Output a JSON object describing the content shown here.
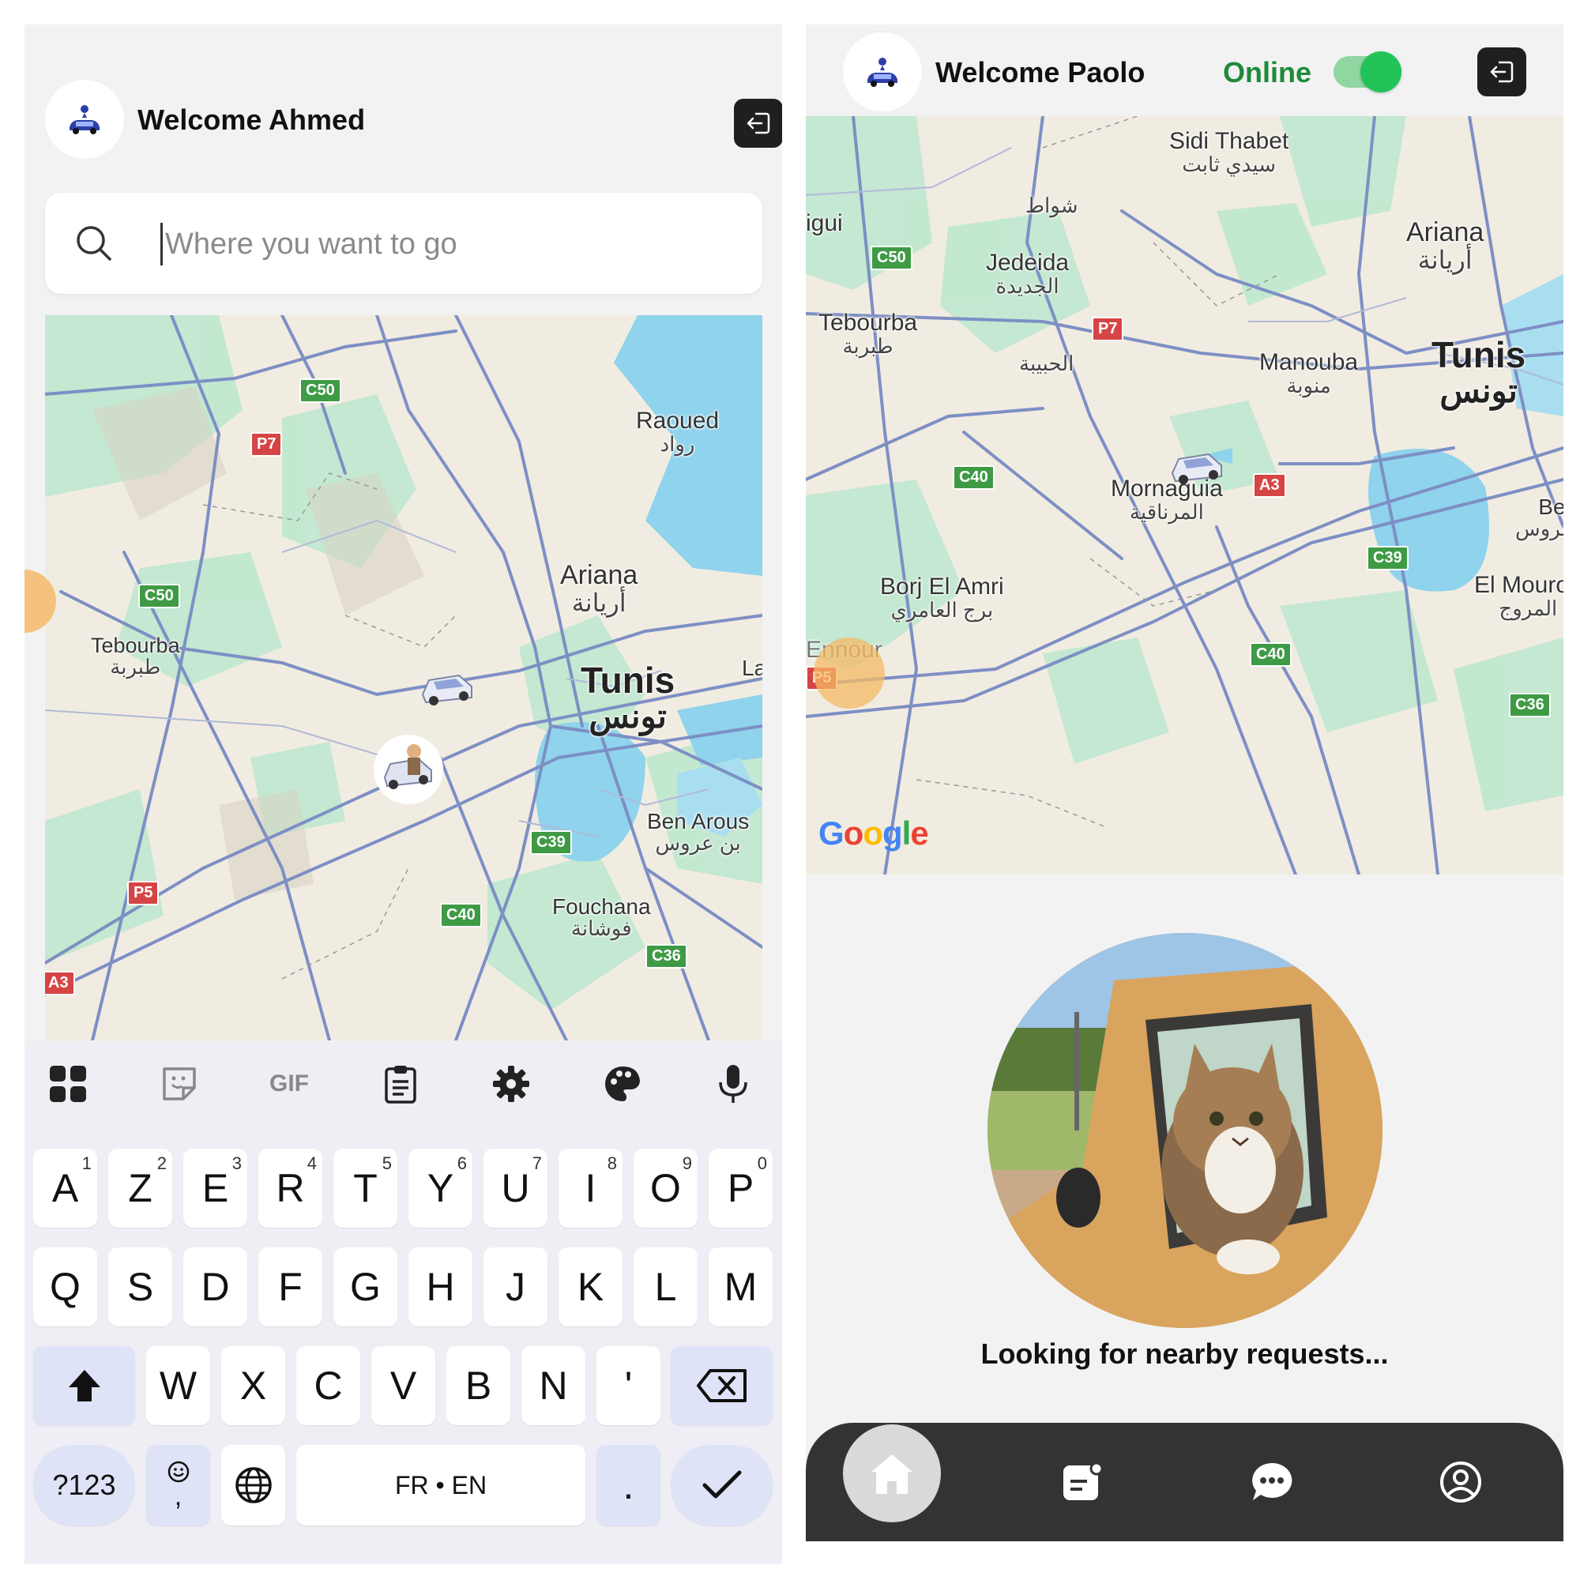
{
  "left_screen": {
    "welcome": "Welcome Ahmed",
    "search": {
      "placeholder": "Where you want to go",
      "value": ""
    },
    "map_places": [
      {
        "name": "Raoued",
        "arabic": "رواد"
      },
      {
        "name": "Ariana",
        "arabic": "أريانة"
      },
      {
        "name": "Tunis",
        "arabic": "تونس"
      },
      {
        "name": "Tebourba",
        "arabic": "طبربة"
      },
      {
        "name": "Ben Arous",
        "arabic": "بن عروس"
      },
      {
        "name": "Fouchana",
        "arabic": "فوشانة"
      },
      {
        "name": "La",
        "arabic": ""
      }
    ],
    "road_shields": [
      "C50",
      "P7",
      "C50",
      "C39",
      "C40",
      "C36",
      "P5",
      "A3"
    ],
    "keyboard": {
      "toolbar": [
        "apps-grid-icon",
        "sticker-icon",
        "GIF",
        "clipboard-icon",
        "settings-gear-icon",
        "palette-icon",
        "microphone-icon"
      ],
      "row1": [
        [
          "A",
          "1"
        ],
        [
          "Z",
          "2"
        ],
        [
          "E",
          "3"
        ],
        [
          "R",
          "4"
        ],
        [
          "T",
          "5"
        ],
        [
          "Y",
          "6"
        ],
        [
          "U",
          "7"
        ],
        [
          "I",
          "8"
        ],
        [
          "O",
          "9"
        ],
        [
          "P",
          "0"
        ]
      ],
      "row2": [
        "Q",
        "S",
        "D",
        "F",
        "G",
        "H",
        "J",
        "K",
        "L",
        "M"
      ],
      "row3": [
        "W",
        "X",
        "C",
        "V",
        "B",
        "N",
        "'"
      ],
      "symbols_key": "?123",
      "emoji_comma_key": ",",
      "space_label": "FR • EN",
      "period_key": ".",
      "colors": {
        "special_key": "#dfe3f7",
        "key": "#ffffff",
        "background": "#eeeef4"
      }
    }
  },
  "right_screen": {
    "welcome": "Welcome Paolo",
    "status": "Online",
    "online_toggle": true,
    "map_places": [
      {
        "name": "Sidi Thabet",
        "arabic": "سيدي ثابت"
      },
      {
        "name": "igui",
        "arabic": ""
      },
      {
        "name": "",
        "arabic": "شواط"
      },
      {
        "name": "Jedeida",
        "arabic": "الجديدة"
      },
      {
        "name": "Ariana",
        "arabic": "أريانة"
      },
      {
        "name": "Tebourba",
        "arabic": "طبربة"
      },
      {
        "name": "",
        "arabic": "الحبيبة"
      },
      {
        "name": "Manouba",
        "arabic": "منوبة"
      },
      {
        "name": "Tunis",
        "arabic": "تونس"
      },
      {
        "name": "Mornaguia",
        "arabic": "المرناقية"
      },
      {
        "name": "Ben",
        "arabic": "بن عروس"
      },
      {
        "name": "Borj El Amri",
        "arabic": "برج العامري"
      },
      {
        "name": "El Mourou",
        "arabic": "المروج"
      },
      {
        "name": "Ennour",
        "arabic": ""
      }
    ],
    "road_shields": [
      "C50",
      "P7",
      "C40",
      "A3",
      "C39",
      "C40",
      "C36",
      "P5"
    ],
    "map_attribution": "Google",
    "looking_text": "Looking for nearby requests...",
    "bottom_nav": [
      "home-icon",
      "requests-icon",
      "chat-icon",
      "profile-icon"
    ],
    "colors": {
      "online_green": "#1e8a3a",
      "toggle_knob": "#22c45a",
      "nav_bg": "#333333"
    }
  }
}
